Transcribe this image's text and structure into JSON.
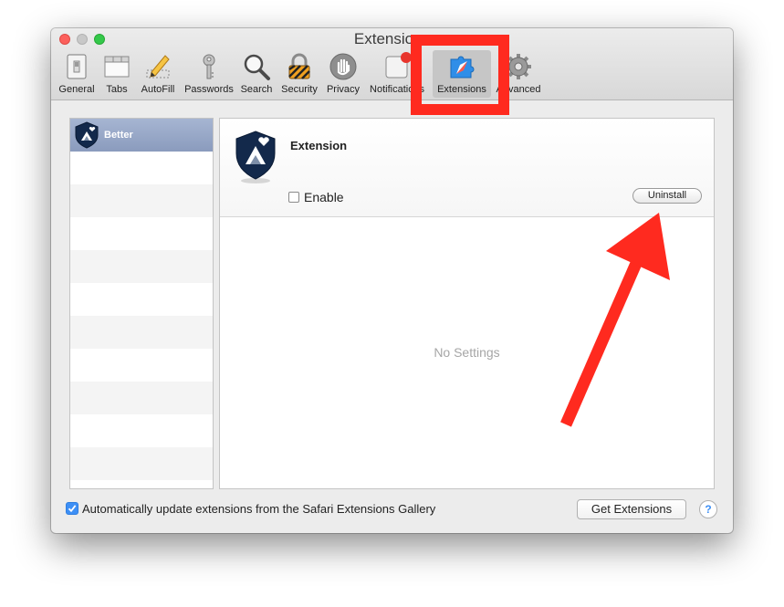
{
  "window": {
    "title": "Extensions"
  },
  "toolbar": [
    {
      "label": "General",
      "icon": "switch-icon"
    },
    {
      "label": "Tabs",
      "icon": "tabs-icon"
    },
    {
      "label": "AutoFill",
      "icon": "pencil-icon"
    },
    {
      "label": "Passwords",
      "icon": "key-icon"
    },
    {
      "label": "Search",
      "icon": "magnifier-icon"
    },
    {
      "label": "Security",
      "icon": "padlock-icon"
    },
    {
      "label": "Privacy",
      "icon": "hand-icon"
    },
    {
      "label": "Notifications",
      "icon": "notification-icon"
    },
    {
      "label": "Extensions",
      "icon": "puzzle-icon",
      "selected": true
    },
    {
      "label": "Advanced",
      "icon": "gear-icon"
    }
  ],
  "sidebar": {
    "selected_label": "Better",
    "row_count": 10
  },
  "detail": {
    "extension_name": "Extension",
    "enable_label": "Enable",
    "enable_checked": false,
    "uninstall_label": "Uninstall",
    "empty_text": "No Settings"
  },
  "footer": {
    "auto_update_label": "Automatically update extensions from the Safari Extensions Gallery",
    "auto_update_checked": true,
    "get_extensions_label": "Get Extensions",
    "help_label": "?"
  },
  "annotation_color": "#ff2a1f",
  "accent_color": "#3d8ff5"
}
